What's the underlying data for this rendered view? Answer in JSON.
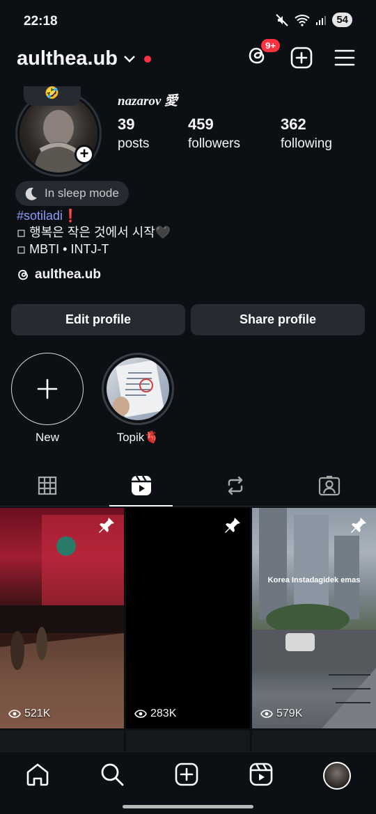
{
  "status_bar": {
    "time": "22:18",
    "battery": "54"
  },
  "header": {
    "username": "aulthea.ub",
    "notification_badge": "9+"
  },
  "profile": {
    "note_emoji": "🤣",
    "display_name": "nazarov 愛",
    "stats": [
      {
        "value": "39",
        "label": "posts"
      },
      {
        "value": "459",
        "label": "followers"
      },
      {
        "value": "362",
        "label": "following"
      }
    ],
    "status_pill": "In sleep mode",
    "bio": {
      "hashtag": "#sotiladi",
      "hashtag_suffix": "❗",
      "line2": "◽ 행복은 작은 것에서 시작🖤",
      "line3": "◽ MBTI • INTJ-T"
    },
    "threads_handle": "aulthea.ub"
  },
  "buttons": {
    "edit": "Edit profile",
    "share": "Share profile"
  },
  "highlights": [
    {
      "label": "New"
    },
    {
      "label": "Topik🫀"
    }
  ],
  "tabs": [
    "grid",
    "reels",
    "reposts",
    "tagged"
  ],
  "active_tab": "reels",
  "reels": [
    {
      "views": "521K",
      "pinned": true,
      "overlay": ""
    },
    {
      "views": "283K",
      "pinned": true,
      "overlay": ""
    },
    {
      "views": "579K",
      "pinned": true,
      "overlay": "Korea Instadagidek emas"
    }
  ],
  "colors": {
    "background": "#0c1014",
    "button": "#262b31",
    "accent_red": "#ff3040",
    "hashtag": "#8c9cf9"
  }
}
